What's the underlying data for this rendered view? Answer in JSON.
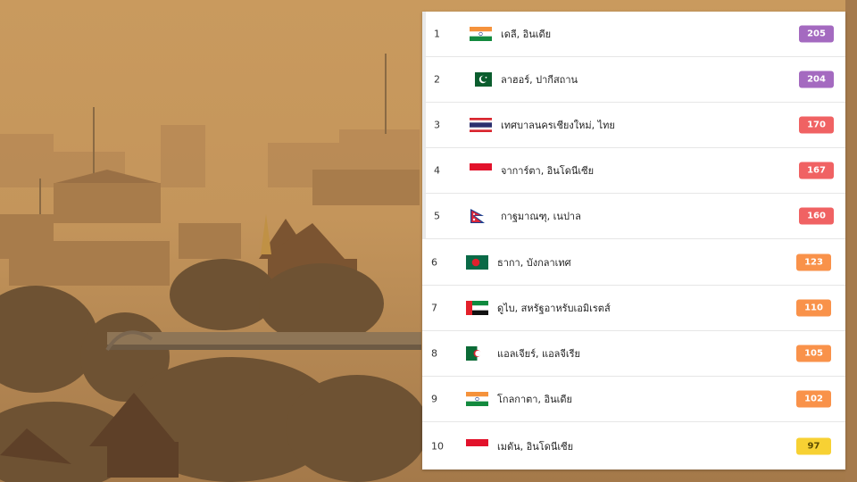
{
  "colors": {
    "aqi_very_unhealthy": "#a46ac0",
    "aqi_unhealthy": "#f06263",
    "aqi_unhealthy_sensitive": "#f9924a",
    "aqi_moderate": "#f7d133"
  },
  "ranking": [
    {
      "rank": "1",
      "city": "เดลี, อินเดีย",
      "aqi": "205",
      "flag": "india-flag-icon",
      "level": "aqi_very_unhealthy"
    },
    {
      "rank": "2",
      "city": "ลาฮอร์, ปากีสถาน",
      "aqi": "204",
      "flag": "pakistan-flag-icon",
      "level": "aqi_very_unhealthy"
    },
    {
      "rank": "3",
      "city": "เทศบาลนครเชียงใหม่, ไทย",
      "aqi": "170",
      "flag": "thailand-flag-icon",
      "level": "aqi_unhealthy"
    },
    {
      "rank": "4",
      "city": "จาการ์ตา, อินโดนีเซีย",
      "aqi": "167",
      "flag": "indonesia-flag-icon",
      "level": "aqi_unhealthy"
    },
    {
      "rank": "5",
      "city": "กาฐมาณฑุ, เนปาล",
      "aqi": "160",
      "flag": "nepal-flag-icon",
      "level": "aqi_unhealthy"
    },
    {
      "rank": "6",
      "city": "ธากา, บังกลาเทศ",
      "aqi": "123",
      "flag": "bangladesh-flag-icon",
      "level": "aqi_unhealthy_sensitive"
    },
    {
      "rank": "7",
      "city": "ดูไบ, สหรัฐอาหรับเอมิเรตส์",
      "aqi": "110",
      "flag": "uae-flag-icon",
      "level": "aqi_unhealthy_sensitive"
    },
    {
      "rank": "8",
      "city": "แอลเจียร์, แอลจีเรีย",
      "aqi": "105",
      "flag": "algeria-flag-icon",
      "level": "aqi_unhealthy_sensitive"
    },
    {
      "rank": "9",
      "city": "โกลกาตา, อินเดีย",
      "aqi": "102",
      "flag": "india-flag-icon",
      "level": "aqi_unhealthy_sensitive"
    },
    {
      "rank": "10",
      "city": "เมดัน, อินโดนีเซีย",
      "aqi": "97",
      "flag": "indonesia-flag-icon",
      "level": "aqi_moderate"
    }
  ]
}
